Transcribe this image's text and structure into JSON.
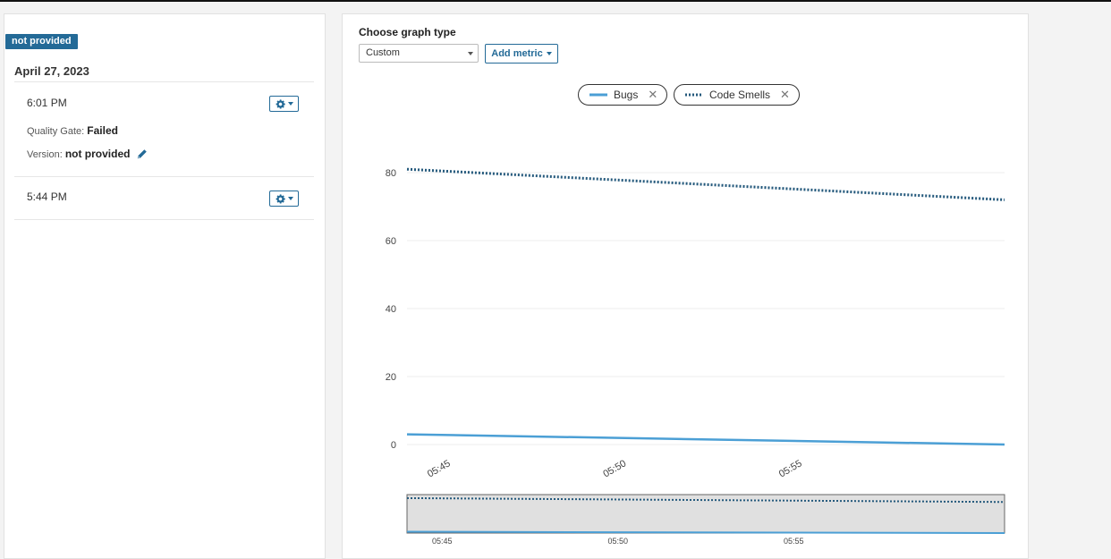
{
  "history": {
    "version_badge": "not provided",
    "date": "April 27, 2023",
    "entries": [
      {
        "time": "6:01 PM",
        "quality_gate_label": "Quality Gate:",
        "quality_gate_value": "Failed",
        "version_label": "Version:",
        "version_value": "not provided"
      },
      {
        "time": "5:44 PM"
      }
    ]
  },
  "graph": {
    "choose_label": "Choose graph type",
    "selected_type": "Custom",
    "add_metric_label": "Add metric",
    "legend": [
      {
        "name": "Bugs",
        "style": "solid"
      },
      {
        "name": "Code Smells",
        "style": "dotted"
      }
    ]
  },
  "colors": {
    "accent": "#236a97",
    "bugs": "#4b9fd5",
    "code_smells": "#24597c",
    "zoom_bg": "#e0e0e0"
  },
  "chart_data": {
    "type": "line",
    "xlabel": "",
    "ylabel": "",
    "ylim": [
      0,
      80
    ],
    "yticks": [
      0,
      20,
      40,
      60,
      80
    ],
    "xticks": [
      "05:45",
      "05:50",
      "05:55"
    ],
    "series": [
      {
        "name": "Bugs",
        "x": [
          "05:44",
          "05:61"
        ],
        "values": [
          3,
          0
        ]
      },
      {
        "name": "Code Smells",
        "x": [
          "05:44",
          "05:61"
        ],
        "values": [
          81,
          72
        ]
      }
    ]
  }
}
